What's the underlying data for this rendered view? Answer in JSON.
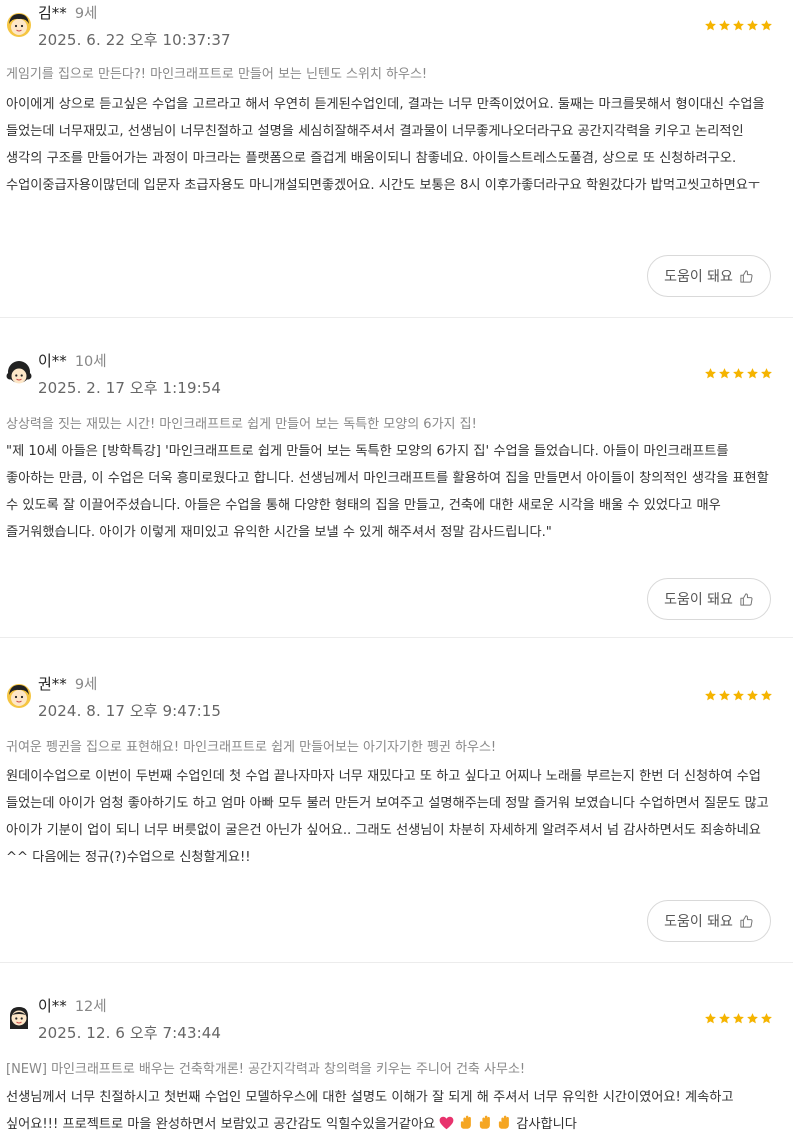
{
  "star_color": "#f5b400",
  "reviews": [
    {
      "avatar": "girl-avatar",
      "name": "김**",
      "age": "9세",
      "date": "2025. 6. 22 오후 10:37:37",
      "rating": 5,
      "course": "게임기를 집으로 만든다?! 마인크래프트로 만들어 보는 닌텐도 스위치 하우스!",
      "body": "아이에게 상으로 듣고싶은 수업을 고르라고 해서 우연히 듣게된수업인데, 결과는 너무 만족이었어요. 둘째는 마크를못해서 형이대신 수업을 들었는데 너무재밌고, 선생님이 너무친절하고 설명을 세심히잘해주셔서 결과물이 너무좋게나오더라구요 공간지각력을 키우고 논리적인 생각의 구조를 만들어가는 과정이 마크라는 플랫폼으로 즐겁게 배움이되니 참좋네요. 아이들스트레스도풀겸, 상으로 또 신청하려구오. 수업이중급자용이많던데 입문자 초급자용도 마니개설되면좋겠어요. 시간도 보통은 8시 이후가좋더라구요 학원갔다가 밥먹고씻고하면요ㅜ",
      "help_label": "도움이 돼요"
    },
    {
      "avatar": "curly-hair-avatar",
      "name": "이**",
      "age": "10세",
      "date": "2025. 2. 17 오후 1:19:54",
      "rating": 5,
      "course": "상상력을 짓는 재밌는 시간! 마인크래프트로 쉽게 만들어 보는 독특한 모양의 6가지 집!",
      "body": "\"제 10세 아들은 [방학특강] '마인크래프트로 쉽게 만들어 보는 독특한 모양의 6가지 집' 수업을 들었습니다. 아들이 마인크래프트를 좋아하는 만큼, 이 수업은 더욱 흥미로웠다고 합니다. 선생님께서 마인크래프트를 활용하여 집을 만들면서 아이들이 창의적인 생각을 표현할 수 있도록 잘 이끌어주셨습니다. 아들은 수업을 통해 다양한 형태의 집을 만들고, 건축에 대한 새로운 시각을 배울 수 있었다고 매우 즐거워했습니다. 아이가 이렇게 재미있고 유익한 시간을 보낼 수 있게 해주셔서 정말 감사드립니다.\"",
      "help_label": "도움이 돼요"
    },
    {
      "avatar": "girl-avatar",
      "name": "권**",
      "age": "9세",
      "date": "2024. 8. 17 오후 9:47:15",
      "rating": 5,
      "course": "귀여운 펭귄을 집으로 표현해요! 마인크래프트로 쉽게 만들어보는 아기자기한 펭귄 하우스!",
      "body": "원데이수업으로 이번이 두번째 수업인데 첫 수업 끝나자마자 너무 재밌다고 또 하고 싶다고 어찌나 노래를 부르는지 한번 더 신청하여 수업 들었는데 아이가 엄청 좋아하기도 하고 엄마 아빠 모두 불러 만든거 보여주고 설명해주는데 정말 즐거워 보였습니다 수업하면서 질문도 많고 아이가 기분이 업이 되니 너무 버릇없이 굴은건 아닌가 싶어요.. 그래도 선생님이 차분히 자세하게 알려주셔서 넘 감사하면서도 죄송하네요^^ 다음에는 정규(?)수업으로 신청할게요!!",
      "help_label": "도움이 돼요"
    },
    {
      "avatar": "long-hair-avatar",
      "name": "이**",
      "age": "12세",
      "date": "2025. 12. 6 오후 7:43:44",
      "rating": 5,
      "course": "[NEW] 마인크래프트로 배우는 건축학개론! 공간지각력과 창의력을 키우는 주니어 건축 사무소!",
      "body": "선생님께서 너무 친절하시고 첫번째 수업인 모델하우스에 대한 설명도 이해가 잘 되게 해 주셔서 너무 유익한 시간이였어요! 계속하고 싶어요!!! 프로젝트로 마을 완성하면서 보람있고 공간감도 익힐수있을거같아요",
      "body_suffix": "감사합니다",
      "help_label": "도움이 돼요"
    }
  ]
}
